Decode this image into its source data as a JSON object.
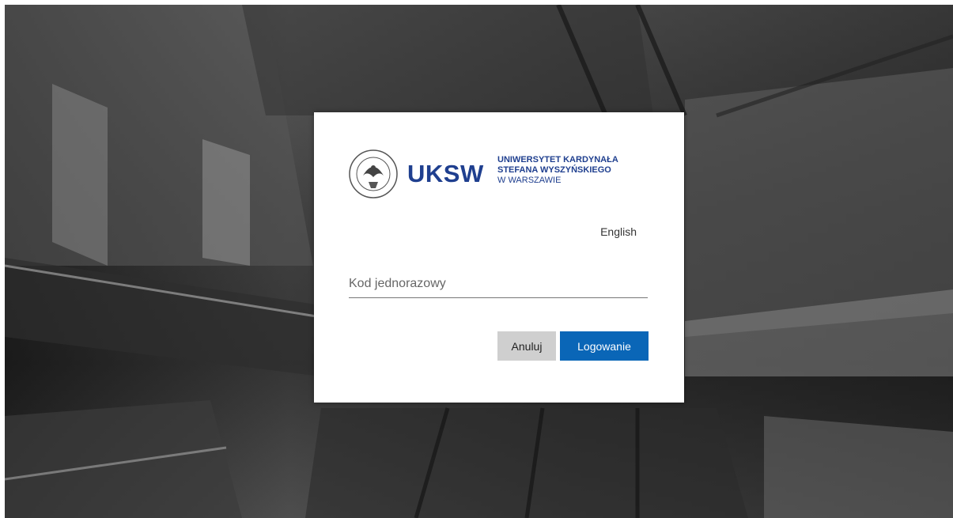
{
  "logo": {
    "seal_icon": "university-seal-icon",
    "wordmark": "UKSW",
    "name_line1": "UNIWERSYTET KARDYNAŁA",
    "name_line2": "STEFANA WYSZYŃSKIEGO",
    "name_line3": "W WARSZAWIE",
    "brand_color": "#1f3f8f"
  },
  "language_link": "English",
  "otp_field": {
    "placeholder": "Kod jednorazowy",
    "value": ""
  },
  "buttons": {
    "cancel_label": "Anuluj",
    "login_label": "Logowanie",
    "login_color": "#0a66b7",
    "cancel_color": "#cfcfcf"
  }
}
